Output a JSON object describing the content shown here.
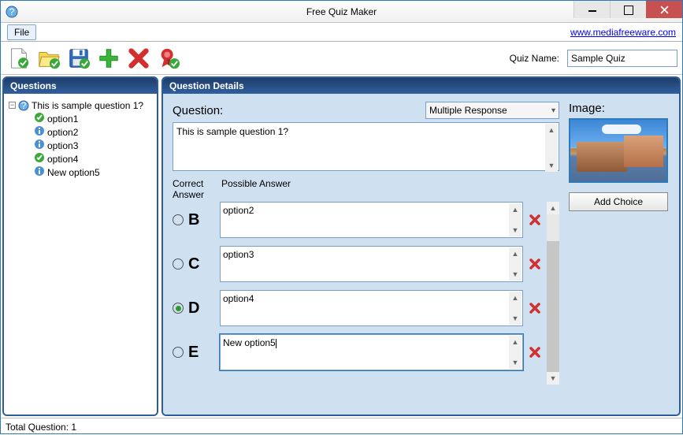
{
  "window": {
    "title": "Free Quiz Maker"
  },
  "menubar": {
    "file_label": "File",
    "link_text": "www.mediafreeware.com"
  },
  "toolbar": {
    "quiz_name_label": "Quiz Name:",
    "quiz_name_value": "Sample Quiz"
  },
  "panels": {
    "questions_title": "Questions",
    "details_title": "Question Details"
  },
  "tree": {
    "root_label": "This is sample question 1?",
    "children": [
      {
        "label": "option1",
        "icon": "check"
      },
      {
        "label": "option2",
        "icon": "info"
      },
      {
        "label": "option3",
        "icon": "info"
      },
      {
        "label": "option4",
        "icon": "check"
      },
      {
        "label": "New option5",
        "icon": "info"
      }
    ]
  },
  "details": {
    "question_label": "Question:",
    "question_type": "Multiple Response",
    "question_text": "This is sample question 1?",
    "correct_header": "Correct Answer",
    "possible_header": "Possible Answer",
    "image_label": "Image:",
    "add_choice_label": "Add Choice",
    "answers": [
      {
        "letter": "B",
        "text": "option2",
        "checked": false
      },
      {
        "letter": "C",
        "text": "option3",
        "checked": false
      },
      {
        "letter": "D",
        "text": "option4",
        "checked": true
      },
      {
        "letter": "E",
        "text": "New option5",
        "checked": false,
        "active": true
      }
    ]
  },
  "status": {
    "total_label": "Total Question:",
    "total_value": "1"
  }
}
